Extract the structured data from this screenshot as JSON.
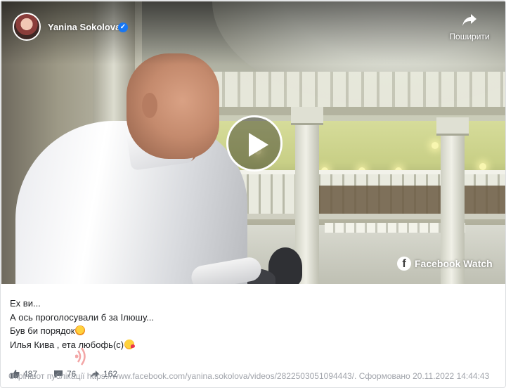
{
  "post": {
    "author": "Yanina Sokolova",
    "verified_mark": "✓",
    "share_label": "Поширити",
    "watch_label": "Facebook Watch",
    "fb_letter": "f"
  },
  "caption": {
    "lines": [
      "Ех ви...",
      "А ось проголосували б за Ілюшу...",
      "Був би порядок",
      "Илья Кива , ета любофь(с)"
    ]
  },
  "stats": {
    "likes": "487",
    "comments": "76",
    "shares": "162"
  },
  "source_note": "Скріншот публікації https://www.facebook.com/yanina.sokolova/videos/2822503051094443/. Сформовано 20.11.2022 14:44:43",
  "colors": {
    "accent": "#1877f2",
    "text": "#1c1e21",
    "muted": "#606770"
  },
  "icons": [
    "share-arrow-icon",
    "play-icon",
    "facebook-logo-icon",
    "like-icon",
    "comment-icon",
    "share-count-icon",
    "fire-emoji-icon",
    "kiss-emoji-icon",
    "sound-icon"
  ]
}
